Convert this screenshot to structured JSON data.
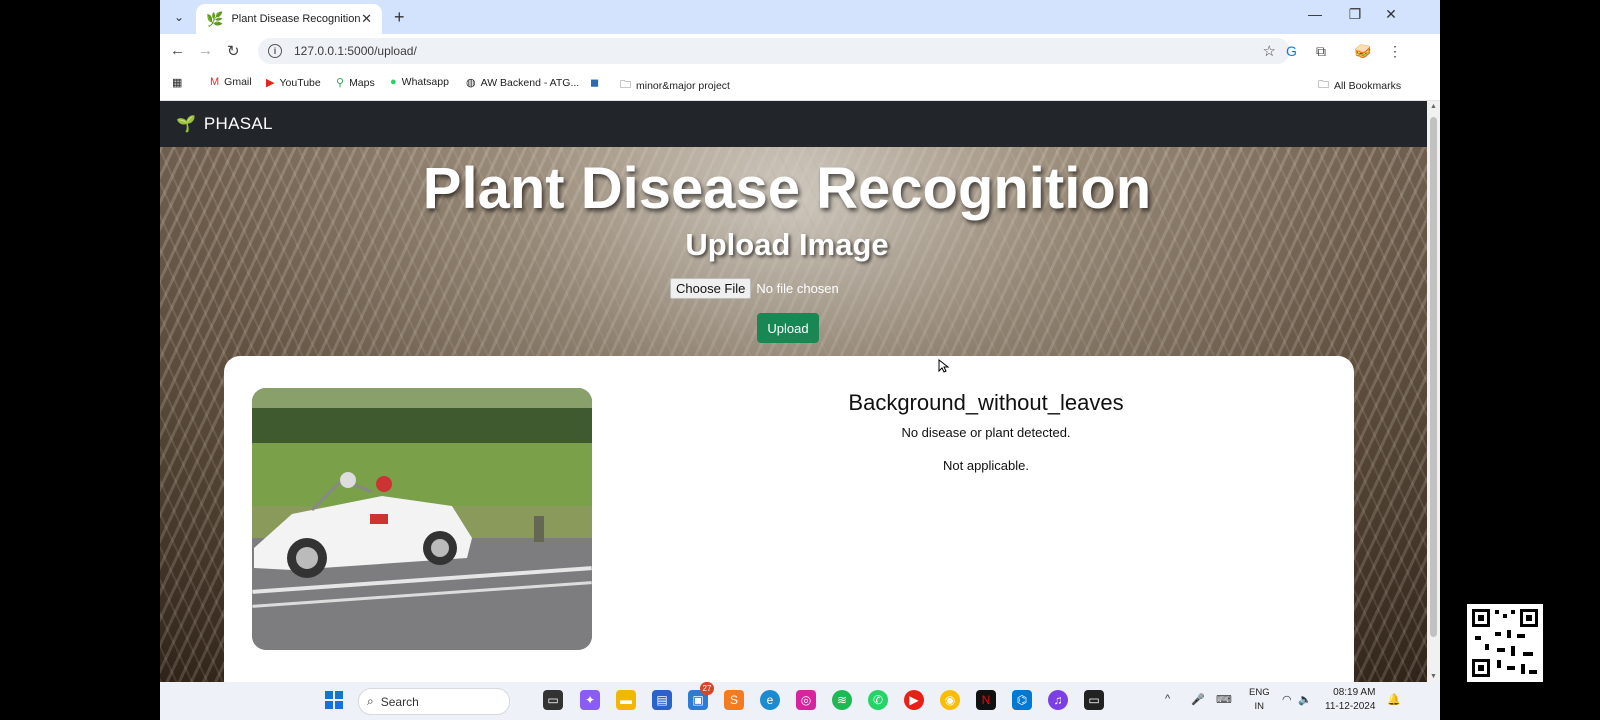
{
  "browser": {
    "tab_title": "Plant Disease Recognition",
    "url": "127.0.0.1:5000/upload/",
    "bookmarks": [
      "Gmail",
      "YouTube",
      "Maps",
      "Whatsapp",
      "AW Backend - ATG...",
      "minor&major project"
    ],
    "all_bookmarks": "All Bookmarks"
  },
  "page": {
    "brand": "PHASAL",
    "title": "Plant Disease Recognition",
    "subtitle": "Upload Image",
    "choose_file": "Choose File",
    "no_file": "No file chosen",
    "upload_button": "Upload"
  },
  "result": {
    "label": "Background_without_leaves",
    "status": "No disease or plant detected.",
    "treatment": "Not applicable."
  },
  "taskbar": {
    "search": "Search",
    "badge_count": "27",
    "lang_top": "ENG",
    "lang_bottom": "IN",
    "time": "08:19 AM",
    "date": "11-12-2024"
  },
  "colors": {
    "navbar": "#22262b",
    "upload_button": "#198754",
    "tab_strip": "#d3e3fd"
  }
}
